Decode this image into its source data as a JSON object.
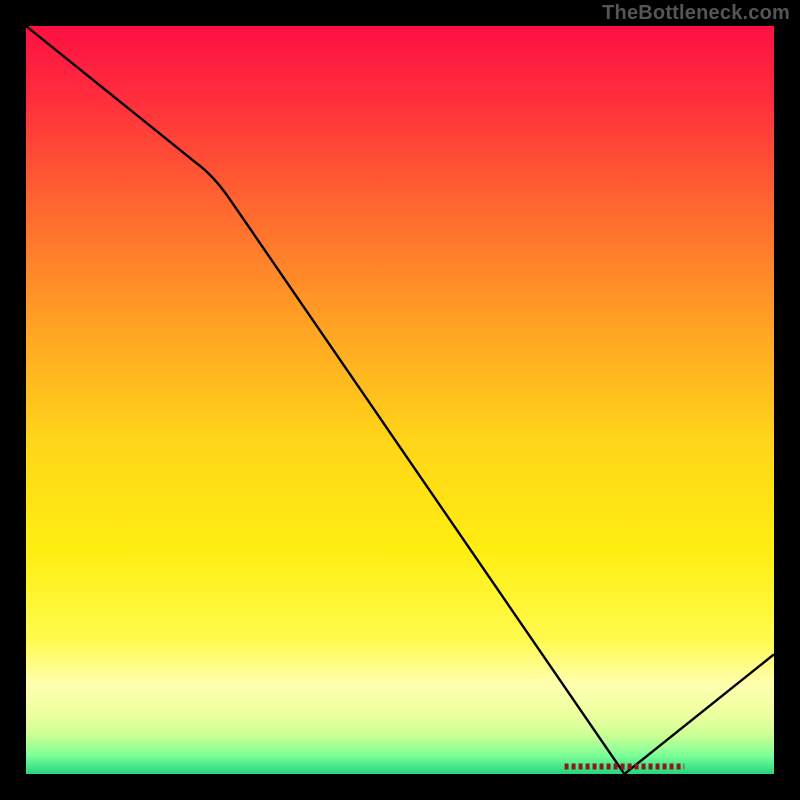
{
  "attribution": "TheBottleneck.com",
  "chart_data": {
    "type": "line",
    "title": "",
    "xlabel": "",
    "ylabel": "",
    "xlim": [
      0,
      100
    ],
    "ylim": [
      0,
      100
    ],
    "x": [
      0,
      25,
      80,
      100
    ],
    "values": [
      100,
      80,
      0,
      16
    ],
    "minimum_x": 80,
    "annotation_label": "",
    "gradient_stops": [
      {
        "offset": 0.0,
        "color": "#fe1043"
      },
      {
        "offset": 0.1,
        "color": "#ff2f3c"
      },
      {
        "offset": 0.25,
        "color": "#ff6a2f"
      },
      {
        "offset": 0.4,
        "color": "#ffa224"
      },
      {
        "offset": 0.55,
        "color": "#ffd419"
      },
      {
        "offset": 0.7,
        "color": "#ffee12"
      },
      {
        "offset": 0.82,
        "color": "#fffb4d"
      },
      {
        "offset": 0.88,
        "color": "#ffffb0"
      },
      {
        "offset": 0.92,
        "color": "#eeff9f"
      },
      {
        "offset": 0.95,
        "color": "#c8ff94"
      },
      {
        "offset": 0.975,
        "color": "#7dff98"
      },
      {
        "offset": 1.0,
        "color": "#24d57f"
      }
    ],
    "curve_color": "#000000",
    "marker_color": "#8a1a1a"
  }
}
